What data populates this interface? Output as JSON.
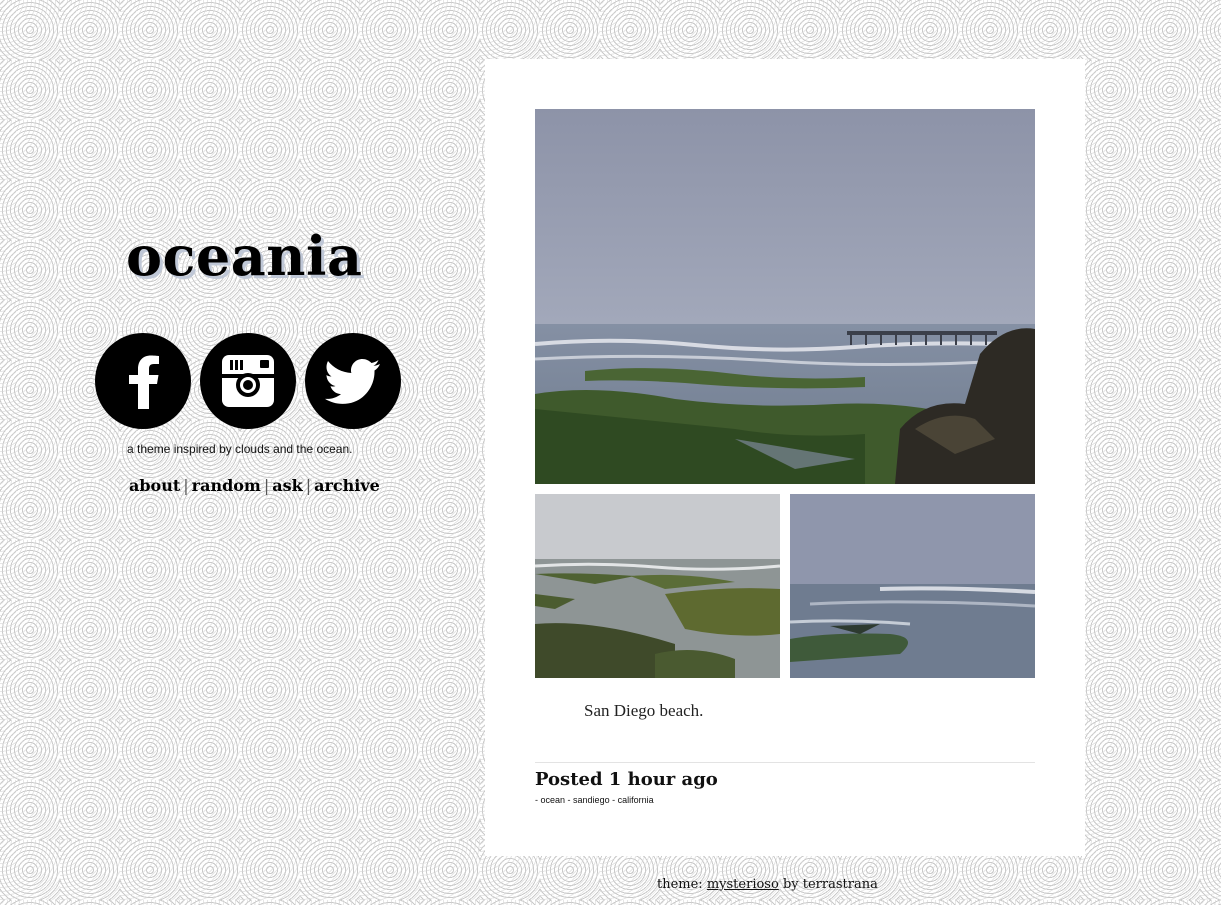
{
  "sidebar": {
    "title": "oceania",
    "tagline": "a theme inspired by clouds and the ocean.",
    "social": [
      {
        "name": "facebook",
        "icon": "facebook-icon"
      },
      {
        "name": "instagram",
        "icon": "instagram-icon"
      },
      {
        "name": "twitter",
        "icon": "twitter-icon"
      }
    ],
    "nav": {
      "about": "about",
      "random": "random",
      "ask": "ask",
      "archive": "archive",
      "separator": "|"
    }
  },
  "post": {
    "caption": "San Diego beach.",
    "posted": "Posted 1 hour ago",
    "tags": [
      "- ocean",
      "- sandiego",
      "- california"
    ]
  },
  "footer": {
    "prefix": "theme:",
    "theme_name": "mysterioso",
    "by_text": "by terrastrana"
  },
  "colors": {
    "background": "#ffffff",
    "pattern": "#c9c9c9",
    "text": "#111111"
  }
}
